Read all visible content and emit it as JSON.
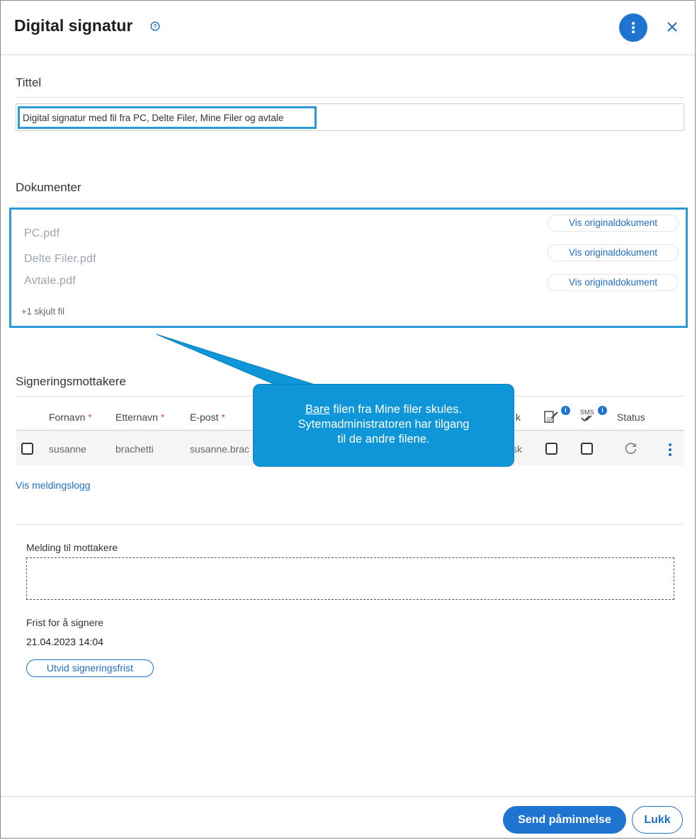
{
  "header": {
    "title": "Digital signatur",
    "help_icon": "question-circle-icon",
    "more_icon": "kebab-vertical-icon",
    "close_icon": "close-x-icon"
  },
  "title_section": {
    "label": "Tittel",
    "value": "Digital signatur med fil fra PC, Delte Filer, Mine Filer og avtale"
  },
  "documents_section": {
    "label": "Dokumenter",
    "files": [
      {
        "name": "PC.pdf",
        "button": "Vis originaldokument"
      },
      {
        "name": "Delte Filer.pdf",
        "button": "Vis originaldokument"
      },
      {
        "name": "Avtale.pdf",
        "button": "Vis originaldokument"
      }
    ],
    "hidden_files": "+1 skjult fil"
  },
  "recipients_section": {
    "label": "Signeringsmottakere",
    "columns": {
      "first_name": "Fornavn",
      "last_name": "Etternavn",
      "email": "E-post",
      "partial": "k",
      "status": "Status",
      "required_marker": "*"
    },
    "column_icons": [
      "sign-document-icon",
      "sms-check-icon"
    ],
    "rows": [
      {
        "first_name": "susanne",
        "last_name": "brachetti",
        "email": "susanne.brac",
        "partial": "sk"
      }
    ],
    "message_log_link": "Vis meldingslogg"
  },
  "message": {
    "label": "Melding til mottakere",
    "value": ""
  },
  "deadline": {
    "label": "Frist for å signere",
    "value": "21.04.2023 14:04",
    "extend_button": "Utvid signeringsfrist"
  },
  "footer": {
    "send_button": "Send påminnelse",
    "close_button": "Lukk"
  },
  "callout": {
    "underlined_word": "Bare",
    "line1_rest": " filen fra Mine filer skules.",
    "line2": "Sytemadministratoren har tilgang",
    "line3": "til de andre filene."
  },
  "colors": {
    "primary": "#1f73d1",
    "highlight_border": "#2b9bd6",
    "callout_bg": "#0f96d8",
    "required": "#d9534f"
  }
}
